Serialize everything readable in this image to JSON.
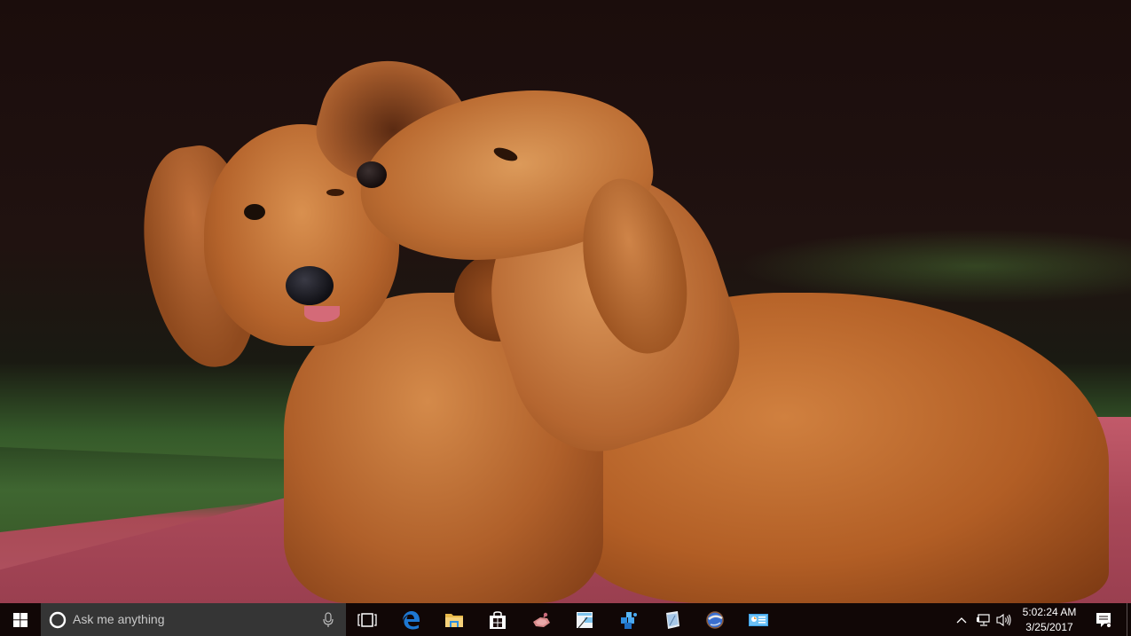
{
  "desktop": {
    "wallpaper": "two-dachshund-puppies-on-red-bench"
  },
  "taskbar": {
    "start": {
      "icon": "windows-logo-icon"
    },
    "search": {
      "placeholder": "Ask me anything",
      "cortana_icon": "cortana-ring-icon",
      "mic_icon": "microphone-icon"
    },
    "task_view": {
      "icon": "task-view-icon"
    },
    "pinned_apps": [
      {
        "name": "Microsoft Edge",
        "icon": "edge-icon",
        "color": "#1e78d2"
      },
      {
        "name": "File Explorer",
        "icon": "file-explorer-icon",
        "color": "#f1c65a"
      },
      {
        "name": "Store",
        "icon": "store-icon",
        "color": "#ffffff"
      },
      {
        "name": "Paint 3D",
        "icon": "paint-icon",
        "color": "#d98a8a"
      },
      {
        "name": "Snipping Tool",
        "icon": "snipping-tool-icon",
        "color": "#7fc4ee"
      },
      {
        "name": "Network",
        "icon": "network-cubes-icon",
        "color": "#2f8ee0"
      },
      {
        "name": "Notepad",
        "icon": "notepad-icon",
        "color": "#a8c8e8"
      },
      {
        "name": "Internet Connection",
        "icon": "globe-icon",
        "color": "#3a6fd0"
      },
      {
        "name": "Control Panel",
        "icon": "control-panel-icon",
        "color": "#3aa0e8"
      }
    ],
    "tray": {
      "chevron_icon": "chevron-up-icon",
      "network_icon": "network-icon",
      "volume_icon": "volume-icon",
      "time": "5:02:24 AM",
      "date": "3/25/2017",
      "action_center_icon": "action-center-icon"
    }
  }
}
